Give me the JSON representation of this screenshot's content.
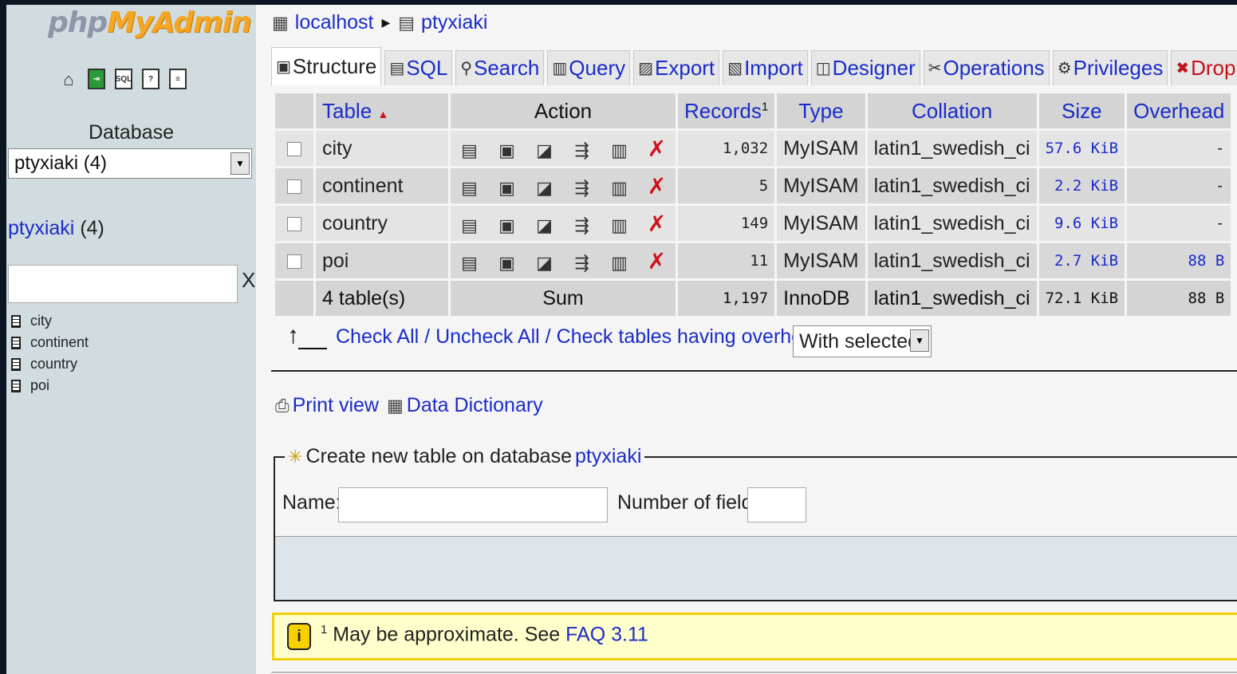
{
  "sidebar": {
    "logo_php": "php",
    "logo_myadmin": "MyAdmin",
    "icons": [
      "home-icon",
      "exit-icon",
      "sql-icon",
      "help-icon",
      "docs-icon"
    ],
    "database_label": "Database",
    "database_select": "ptyxiaki (4)",
    "db_link_name": "ptyxiaki",
    "db_link_count": "(4)",
    "filter_clear": "X",
    "tables": [
      "city",
      "continent",
      "country",
      "poi"
    ]
  },
  "breadcrumb": {
    "server": "localhost",
    "database": "ptyxiaki"
  },
  "tabs": [
    {
      "label": "Structure",
      "icon": "structure-icon",
      "active": true
    },
    {
      "label": "SQL",
      "icon": "sql-icon"
    },
    {
      "label": "Search",
      "icon": "search-icon"
    },
    {
      "label": "Query",
      "icon": "query-icon"
    },
    {
      "label": "Export",
      "icon": "export-icon"
    },
    {
      "label": "Import",
      "icon": "import-icon"
    },
    {
      "label": "Designer",
      "icon": "designer-icon"
    },
    {
      "label": "Operations",
      "icon": "operations-icon"
    },
    {
      "label": "Privileges",
      "icon": "privileges-icon"
    },
    {
      "label": "Drop",
      "icon": "drop-icon"
    }
  ],
  "table": {
    "headers": {
      "table": "Table",
      "action": "Action",
      "records": "Records",
      "records_sup": "1",
      "type": "Type",
      "collation": "Collation",
      "size": "Size",
      "overhead": "Overhead"
    },
    "rows": [
      {
        "name": "city",
        "records": "1,032",
        "type": "MyISAM",
        "collation": "latin1_swedish_ci",
        "size": "57.6 KiB",
        "overhead": "-"
      },
      {
        "name": "continent",
        "records": "5",
        "type": "MyISAM",
        "collation": "latin1_swedish_ci",
        "size": "2.2 KiB",
        "overhead": "-"
      },
      {
        "name": "country",
        "records": "149",
        "type": "MyISAM",
        "collation": "latin1_swedish_ci",
        "size": "9.6 KiB",
        "overhead": "-"
      },
      {
        "name": "poi",
        "records": "11",
        "type": "MyISAM",
        "collation": "latin1_swedish_ci",
        "size": "2.7 KiB",
        "overhead": "88 B"
      }
    ],
    "sum": {
      "count": "4 table(s)",
      "label": "Sum",
      "records": "1,197",
      "type": "InnoDB",
      "collation": "latin1_swedish_ci",
      "size": "72.1 KiB",
      "overhead": "88 B"
    }
  },
  "selection": {
    "check_all": "Check All",
    "uncheck_all": "Uncheck All",
    "check_overhead": "Check tables having overhead",
    "separator": "/",
    "with_selected": "With selected:"
  },
  "links": {
    "print_view": "Print view",
    "data_dictionary": "Data Dictionary"
  },
  "create": {
    "legend": "Create new table on database",
    "db": "ptyxiaki",
    "name_label": "Name:",
    "fields_label": "Number of fields:"
  },
  "note": {
    "sup": "1",
    "text": "May be approximate. See",
    "faq": "FAQ 3.11"
  }
}
